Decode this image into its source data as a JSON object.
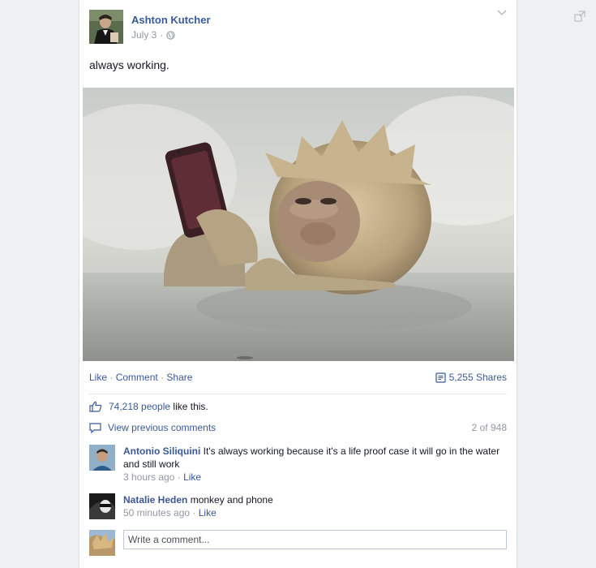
{
  "post": {
    "author": "Ashton Kutcher",
    "date": "July 3",
    "privacy_icon": "globe-icon",
    "text": "always working.",
    "photo_alt": "monkey holding phone in hot spring"
  },
  "actions": {
    "like": "Like",
    "comment": "Comment",
    "share": "Share",
    "shares_count": "5,255 Shares"
  },
  "likes": {
    "count_text": "74,218 people",
    "tail_text": "like this."
  },
  "comments_nav": {
    "view_previous": "View previous comments",
    "position": "2 of 948"
  },
  "comments": [
    {
      "name": "Antonio Siliquini",
      "text": "It's always working because it's a life proof case it will go in the water and still work",
      "time": "3 hours ago",
      "like": "Like"
    },
    {
      "name": "Natalie Heden",
      "text": "monkey and phone",
      "time": "50 minutes ago",
      "like": "Like"
    }
  ],
  "write_comment": {
    "placeholder": "Write a comment..."
  },
  "colors": {
    "link": "#3b5998",
    "muted": "#9197a3"
  }
}
